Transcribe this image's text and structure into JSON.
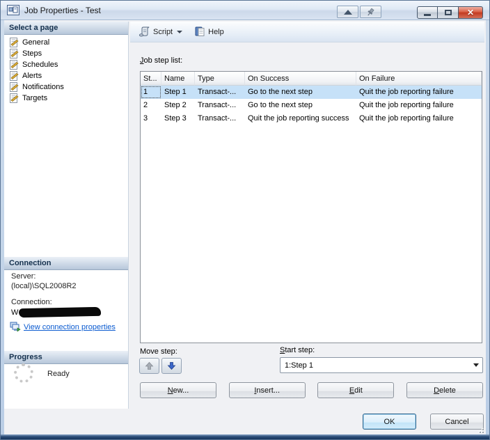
{
  "colors": {
    "selection": "#c6e1f8",
    "link": "#0b5bd0",
    "close_button_red": "#c23a20",
    "window_border_blue": "#b9cde5",
    "bottom_border_navy": "#16345c"
  },
  "window": {
    "title": "Job Properties - Test"
  },
  "sidebar": {
    "select_page": {
      "header": "Select a page",
      "items": [
        {
          "label": "General"
        },
        {
          "label": "Steps"
        },
        {
          "label": "Schedules"
        },
        {
          "label": "Alerts"
        },
        {
          "label": "Notifications"
        },
        {
          "label": "Targets"
        }
      ]
    },
    "connection": {
      "header": "Connection",
      "server_label": "Server:",
      "server_value": "(local)\\SQL2008R2",
      "connection_label": "Connection:",
      "connection_value_visible": "W",
      "link_label": "View connection properties"
    },
    "progress": {
      "header": "Progress",
      "status": "Ready"
    }
  },
  "toolbar": {
    "script_label": "Script",
    "help_label": "Help"
  },
  "main": {
    "list_label": {
      "mnemonic": "J",
      "rest": "ob step list:"
    },
    "table": {
      "columns": [
        "St...",
        "Name",
        "Type",
        "On Success",
        "On Failure"
      ],
      "rows": [
        [
          "1",
          "Step 1",
          "Transact-...",
          "Go to the next step",
          "Quit the job reporting failure"
        ],
        [
          "2",
          "Step 2",
          "Transact-...",
          "Go to the next step",
          "Quit the job reporting failure"
        ],
        [
          "3",
          "Step 3",
          "Transact-...",
          "Quit the job reporting success",
          "Quit the job reporting failure"
        ]
      ],
      "selected_row_index": 0
    },
    "move_step_label": "Move step:",
    "start_step": {
      "label": {
        "mnemonic": "S",
        "rest": "tart step:"
      },
      "value": "1:Step 1"
    },
    "buttons": [
      {
        "mnemonic": "N",
        "rest": "ew..."
      },
      {
        "mnemonic": "I",
        "rest": "nsert..."
      },
      {
        "mnemonic": "E",
        "rest": "dit"
      },
      {
        "mnemonic": "D",
        "rest": "elete"
      }
    ]
  },
  "footer": {
    "ok": "OK",
    "cancel": "Cancel"
  }
}
